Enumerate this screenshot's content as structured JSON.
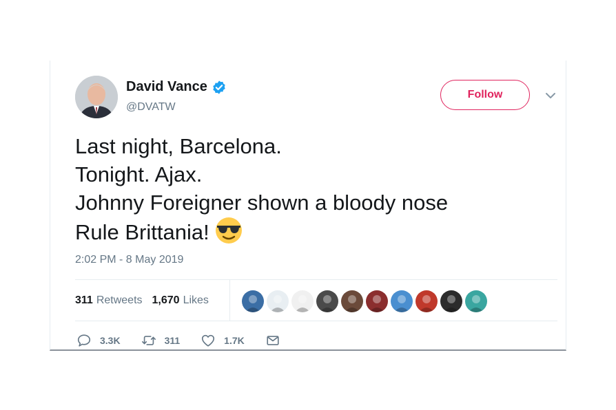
{
  "user": {
    "display_name": "David Vance",
    "handle": "@DVATW",
    "avatar": "profile-photo",
    "verified_icon": "verified-badge-icon"
  },
  "follow_button": {
    "label": "Follow"
  },
  "menu_icon": "chevron-down-icon",
  "tweet": {
    "lines": [
      "Last night, Barcelona.",
      "Tonight. Ajax.",
      "Johnny Foreigner shown a bloody nose",
      "Rule Brittania!"
    ],
    "emoji": "smiling-face-with-sunglasses",
    "timestamp": "2:02 PM - 8 May 2019"
  },
  "stats": {
    "retweets_count": "311",
    "retweets_label": "Retweets",
    "likes_count": "1,670",
    "likes_label": "Likes"
  },
  "liker_avatars": [
    {
      "name": "liker-avatar-1",
      "color": "#3b6ea5"
    },
    {
      "name": "liker-avatar-2",
      "color": "#e8eef2"
    },
    {
      "name": "liker-avatar-3",
      "color": "#f0f0f0"
    },
    {
      "name": "liker-avatar-4",
      "color": "#4a4a4a"
    },
    {
      "name": "liker-avatar-5",
      "color": "#6b4a3a"
    },
    {
      "name": "liker-avatar-6",
      "color": "#8b2e2e"
    },
    {
      "name": "liker-avatar-7",
      "color": "#4a8fd0"
    },
    {
      "name": "liker-avatar-8",
      "color": "#c0392b"
    },
    {
      "name": "liker-avatar-9",
      "color": "#2c2c2c"
    },
    {
      "name": "liker-avatar-10",
      "color": "#3aa6a0"
    }
  ],
  "actions": {
    "replies": "3.3K",
    "retweets": "311",
    "likes": "1.7K"
  },
  "colors": {
    "accent_follow": "#e0245e",
    "verified_blue": "#1da1f2",
    "secondary_text": "#657786"
  }
}
